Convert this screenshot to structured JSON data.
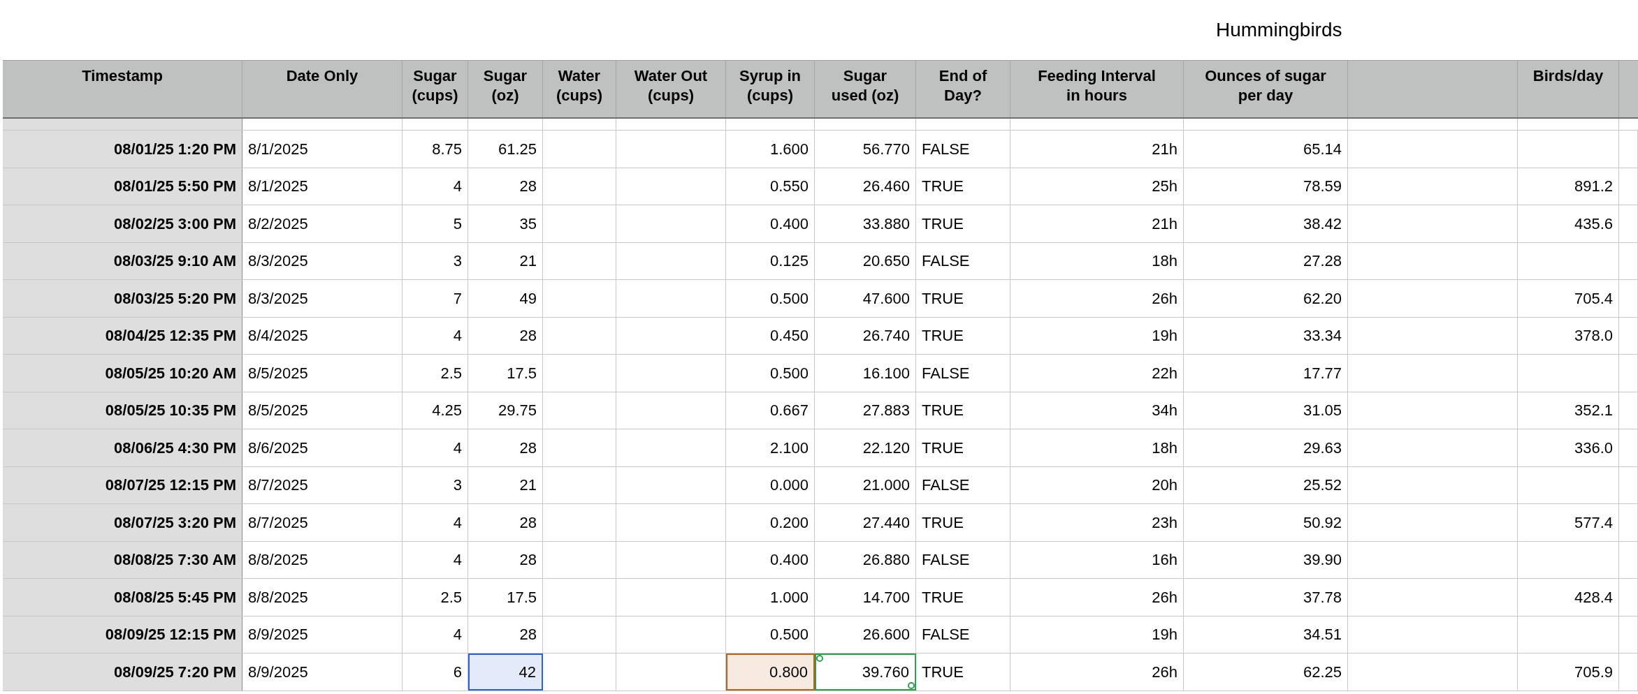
{
  "title": "Hummingbirds",
  "columns": [
    {
      "label": "Timestamp"
    },
    {
      "label": "Date Only"
    },
    {
      "label": "Sugar\n(cups)"
    },
    {
      "label": "Sugar\n(oz)"
    },
    {
      "label": "Water\n(cups)"
    },
    {
      "label": "Water Out\n(cups)"
    },
    {
      "label": "Syrup in\n(cups)"
    },
    {
      "label": "Sugar\nused (oz)"
    },
    {
      "label": "End of\nDay?"
    },
    {
      "label": "Feeding Interval\nin hours"
    },
    {
      "label": "Ounces of sugar\nper day"
    },
    {},
    {
      "label": "Birds/day"
    }
  ],
  "rows": [
    {
      "cells": [
        "08/01/25 1:20 PM",
        "8/1/2025",
        "8.75",
        "61.25",
        null,
        null,
        "1.600",
        "56.770",
        "FALSE",
        "21h",
        "65.14",
        null,
        null
      ]
    },
    {
      "cells": [
        "08/01/25 5:50 PM",
        "8/1/2025",
        "4",
        "28",
        null,
        null,
        "0.550",
        "26.460",
        "TRUE",
        "25h",
        "78.59",
        null,
        "891.2"
      ]
    },
    {
      "cells": [
        "08/02/25 3:00 PM",
        "8/2/2025",
        "5",
        "35",
        null,
        null,
        "0.400",
        "33.880",
        "TRUE",
        "21h",
        "38.42",
        null,
        "435.6"
      ]
    },
    {
      "cells": [
        "08/03/25 9:10 AM",
        "8/3/2025",
        "3",
        "21",
        null,
        null,
        "0.125",
        "20.650",
        "FALSE",
        "18h",
        "27.28",
        null,
        null
      ]
    },
    {
      "cells": [
        "08/03/25 5:20 PM",
        "8/3/2025",
        "7",
        "49",
        null,
        null,
        "0.500",
        "47.600",
        "TRUE",
        "26h",
        "62.20",
        null,
        "705.4"
      ]
    },
    {
      "cells": [
        "08/04/25 12:35 PM",
        "8/4/2025",
        "4",
        "28",
        null,
        null,
        "0.450",
        "26.740",
        "TRUE",
        "19h",
        "33.34",
        null,
        "378.0"
      ]
    },
    {
      "cells": [
        "08/05/25 10:20 AM",
        "8/5/2025",
        "2.5",
        "17.5",
        null,
        null,
        "0.500",
        "16.100",
        "FALSE",
        "22h",
        "17.77",
        null,
        null
      ]
    },
    {
      "cells": [
        "08/05/25 10:35 PM",
        "8/5/2025",
        "4.25",
        "29.75",
        null,
        null,
        "0.667",
        "27.883",
        "TRUE",
        "34h",
        "31.05",
        null,
        "352.1"
      ]
    },
    {
      "cells": [
        "08/06/25 4:30 PM",
        "8/6/2025",
        "4",
        "28",
        null,
        null,
        "2.100",
        "22.120",
        "TRUE",
        "18h",
        "29.63",
        null,
        "336.0"
      ]
    },
    {
      "cells": [
        "08/07/25 12:15 PM",
        "8/7/2025",
        "3",
        "21",
        null,
        null,
        "0.000",
        "21.000",
        "FALSE",
        "20h",
        "25.52",
        null,
        null
      ]
    },
    {
      "cells": [
        "08/07/25 3:20 PM",
        "8/7/2025",
        "4",
        "28",
        null,
        null,
        "0.200",
        "27.440",
        "TRUE",
        "23h",
        "50.92",
        null,
        "577.4"
      ]
    },
    {
      "cells": [
        "08/08/25 7:30 AM",
        "8/8/2025",
        "4",
        "28",
        null,
        null,
        "0.400",
        "26.880",
        "FALSE",
        "16h",
        "39.90",
        null,
        null
      ]
    },
    {
      "cells": [
        "08/08/25 5:45 PM",
        "8/8/2025",
        "2.5",
        "17.5",
        null,
        null,
        "1.000",
        "14.700",
        "TRUE",
        "26h",
        "37.78",
        null,
        "428.4"
      ]
    },
    {
      "cells": [
        "08/09/25 12:15 PM",
        "8/9/2025",
        "4",
        "28",
        null,
        null,
        "0.500",
        "26.600",
        "FALSE",
        "19h",
        "34.51",
        null,
        null
      ]
    },
    {
      "cells": [
        "08/09/25 7:20 PM",
        "8/9/2025",
        "6",
        {
          "text": "42",
          "kind": "selected",
          "color": "#2f5fd0"
        },
        null,
        null,
        {
          "text": "0.800",
          "kind": "reference",
          "color": "#b8651b"
        },
        {
          "text": "39.760",
          "kind": "range",
          "color": "#2e9e4f"
        },
        "TRUE",
        "26h",
        "62.25",
        null,
        "705.9"
      ]
    }
  ]
}
